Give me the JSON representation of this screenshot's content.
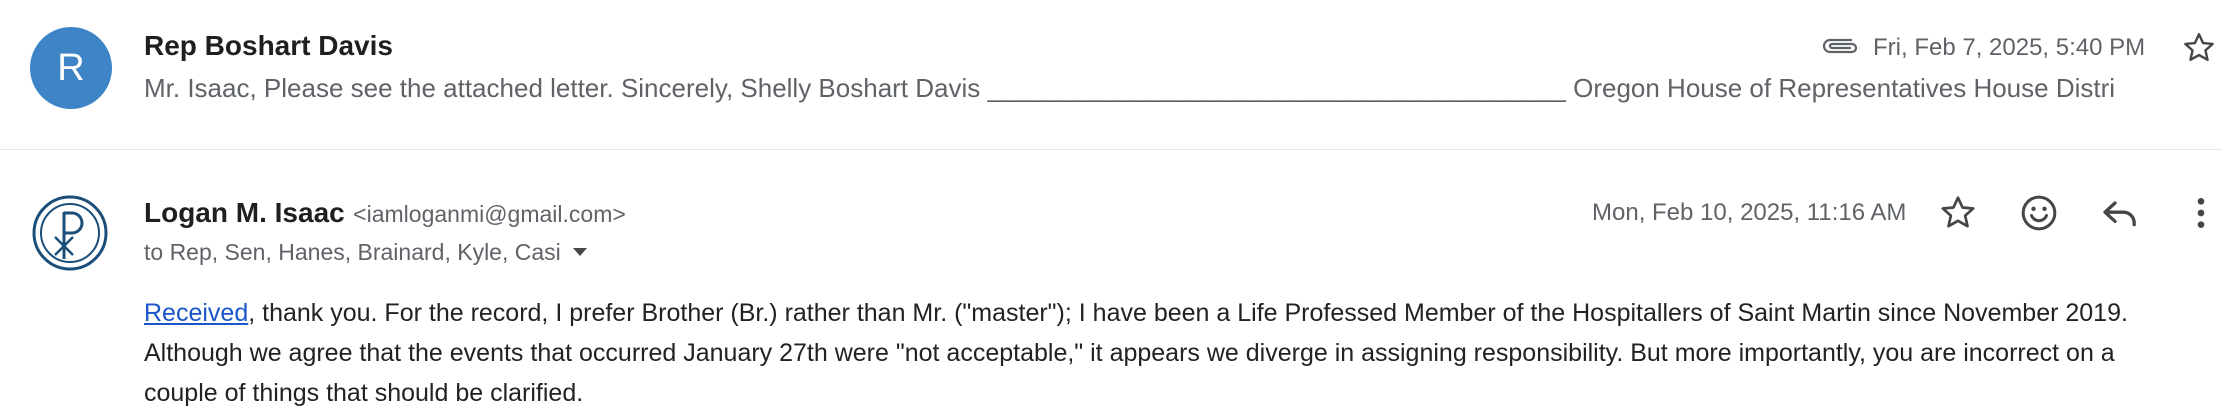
{
  "collapsed_message": {
    "avatar_letter": "R",
    "avatar_color": "#3d85c6",
    "sender": "Rep Boshart Davis",
    "snippet": "Mr. Isaac, Please see the attached letter. Sincerely, Shelly Boshart Davis ________________________________________ Oregon House of Representatives House Distri",
    "attachment_icon": "paperclip-icon",
    "date": "Fri, Feb 7, 2025, 5:40 PM",
    "star_icon": "star-outline-icon"
  },
  "expanded_message": {
    "avatar_icon": "chi-rho-logo",
    "avatar_color": "#1b4f7a",
    "sender_name": "Logan M. Isaac",
    "sender_email": "<iamloganmi@gmail.com>",
    "recipients": "to Rep, Sen, Hanes, Brainard, Kyle, Casi",
    "date": "Mon, Feb 10, 2025, 11:16 AM",
    "actions": {
      "star_icon": "star-outline-icon",
      "react_icon": "emoji-icon",
      "reply_icon": "reply-icon",
      "more_icon": "more-vert-icon"
    },
    "body_link": "Received",
    "body_text": ", thank you. For the record, I prefer Brother (Br.) rather than Mr. (\"master\"); I have been a Life Professed Member of the Hospitallers of Saint Martin since November 2019. Although we agree that the events that occurred January 27th were \"not acceptable,\" it appears we diverge in assigning responsibility. But more importantly, you are incorrect on a couple of things that should be clarified.",
    "link_color": "#1a56c9"
  }
}
